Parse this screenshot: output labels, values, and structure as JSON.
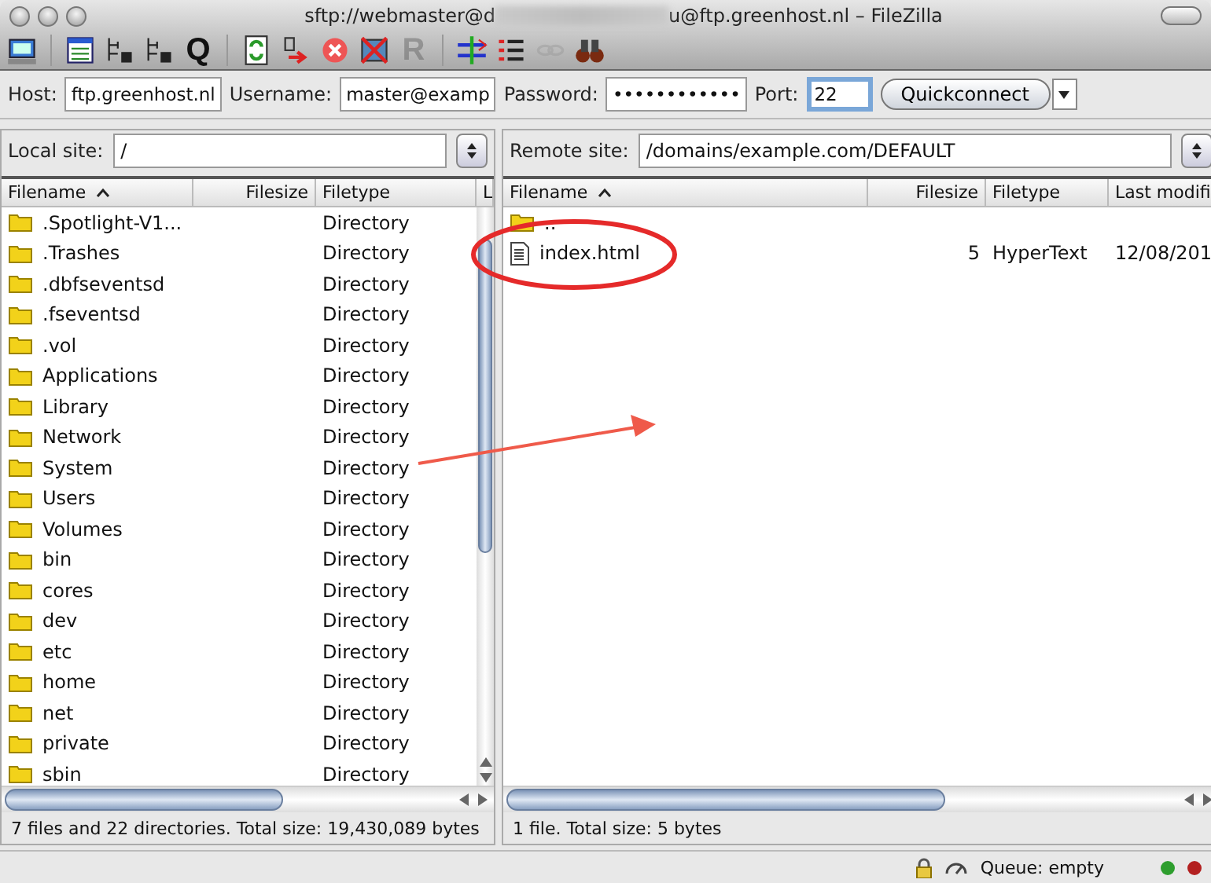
{
  "window": {
    "title_start": "sftp://webmaster@d",
    "title_end": "u@ftp.greenhost.nl – FileZilla"
  },
  "toolbar": [
    {
      "kind": "site-manager",
      "disabled": false
    },
    {
      "kind": "sep"
    },
    {
      "kind": "log",
      "disabled": false
    },
    {
      "kind": "local-tree",
      "disabled": false
    },
    {
      "kind": "remote-tree",
      "disabled": false
    },
    {
      "kind": "letter",
      "text": "Q",
      "disabled": false
    },
    {
      "kind": "sep"
    },
    {
      "kind": "refresh",
      "disabled": false
    },
    {
      "kind": "process-queue",
      "disabled": false
    },
    {
      "kind": "cancel",
      "disabled": false
    },
    {
      "kind": "disconnect",
      "disabled": false
    },
    {
      "kind": "letter",
      "text": "R",
      "disabled": true
    },
    {
      "kind": "sep"
    },
    {
      "kind": "compare",
      "disabled": false
    },
    {
      "kind": "filter",
      "disabled": false
    },
    {
      "kind": "sync",
      "disabled": true
    },
    {
      "kind": "binoculars",
      "disabled": false
    }
  ],
  "quickconnect": {
    "fields": [
      {
        "label": "Host:",
        "value": "ftp.greenhost.nl",
        "focused": false
      },
      {
        "label": "Username:",
        "value": "master@examp",
        "focused": false
      },
      {
        "label": "Password:",
        "value": "••••••••••••",
        "focused": false
      },
      {
        "label": "Port:",
        "value": "22",
        "focused": true
      }
    ],
    "button": "Quickconnect"
  },
  "local": {
    "site_label": "Local site:",
    "path": "/",
    "columns": [
      "Filename",
      "Filesize",
      "Filetype",
      "L"
    ],
    "rows": [
      {
        "kind": "folder",
        "name": ".Spotlight-V1...",
        "size": "",
        "type": "Directory"
      },
      {
        "kind": "folder",
        "name": ".Trashes",
        "size": "",
        "type": "Directory"
      },
      {
        "kind": "folder",
        "name": ".dbfseventsd",
        "size": "",
        "type": "Directory"
      },
      {
        "kind": "folder",
        "name": ".fseventsd",
        "size": "",
        "type": "Directory"
      },
      {
        "kind": "folder",
        "name": ".vol",
        "size": "",
        "type": "Directory"
      },
      {
        "kind": "folder",
        "name": "Applications",
        "size": "",
        "type": "Directory"
      },
      {
        "kind": "folder",
        "name": "Library",
        "size": "",
        "type": "Directory"
      },
      {
        "kind": "folder",
        "name": "Network",
        "size": "",
        "type": "Directory"
      },
      {
        "kind": "folder",
        "name": "System",
        "size": "",
        "type": "Directory"
      },
      {
        "kind": "folder",
        "name": "Users",
        "size": "",
        "type": "Directory"
      },
      {
        "kind": "folder",
        "name": "Volumes",
        "size": "",
        "type": "Directory"
      },
      {
        "kind": "folder",
        "name": "bin",
        "size": "",
        "type": "Directory"
      },
      {
        "kind": "folder",
        "name": "cores",
        "size": "",
        "type": "Directory"
      },
      {
        "kind": "folder",
        "name": "dev",
        "size": "",
        "type": "Directory"
      },
      {
        "kind": "folder",
        "name": "etc",
        "size": "",
        "type": "Directory"
      },
      {
        "kind": "folder",
        "name": "home",
        "size": "",
        "type": "Directory"
      },
      {
        "kind": "folder",
        "name": "net",
        "size": "",
        "type": "Directory"
      },
      {
        "kind": "folder",
        "name": "private",
        "size": "",
        "type": "Directory"
      },
      {
        "kind": "folder",
        "name": "sbin",
        "size": "",
        "type": "Directory"
      }
    ],
    "status": "7 files and 22 directories. Total size: 19,430,089 bytes"
  },
  "remote": {
    "site_label": "Remote site:",
    "path": "/domains/example.com/DEFAULT",
    "columns": [
      "Filename",
      "Filesize",
      "Filetype",
      "Last modifi"
    ],
    "rows": [
      {
        "kind": "folder",
        "name": "..",
        "size": "",
        "type": "",
        "modified": ""
      },
      {
        "kind": "file",
        "name": "index.html",
        "size": "5",
        "type": "HyperText",
        "modified": "12/08/201"
      }
    ],
    "status": "1 file. Total size: 5 bytes"
  },
  "status_bar": {
    "queue": "Queue: empty",
    "lights": [
      {
        "color": "#2e9e2e"
      },
      {
        "color": "#b32020"
      }
    ]
  }
}
